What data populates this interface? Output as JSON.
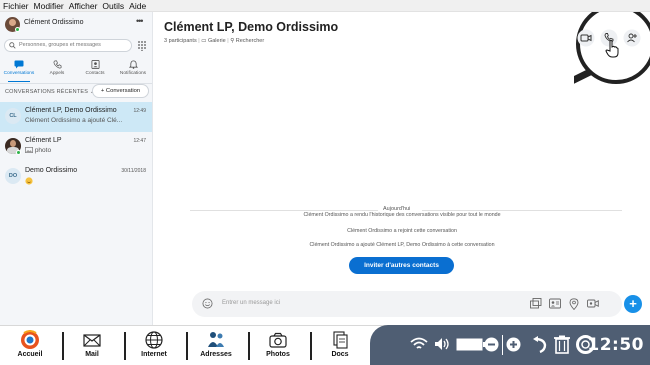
{
  "menubar": {
    "items": [
      "Fichier",
      "Modifier",
      "Afficher",
      "Outils",
      "Aide"
    ]
  },
  "sidebar": {
    "user_name": "Clément Ordissimo",
    "more_label": "•••",
    "search_placeholder": "Personnes, groupes et messages",
    "tabs": [
      {
        "label": "Conversations",
        "icon": "chat-icon"
      },
      {
        "label": "Appels",
        "icon": "phone-icon"
      },
      {
        "label": "Contacts",
        "icon": "contacts-icon"
      },
      {
        "label": "Notifications",
        "icon": "bell-icon"
      }
    ],
    "recent_label": "CONVERSATIONS RÉCENTES",
    "new_conversation_label": "+ Conversation",
    "conversations": [
      {
        "initials": "CL",
        "name": "Clément LP, Demo Ordissimo",
        "time": "12:49",
        "preview": "Clément Ordissimo a ajouté Clé..."
      },
      {
        "initials": "",
        "name": "Clément LP",
        "time": "12:47",
        "preview": "photo"
      },
      {
        "initials": "DO",
        "name": "Demo Ordissimo",
        "time": "30/11/2018",
        "preview": ""
      }
    ]
  },
  "chat": {
    "title": "Clément LP, Demo Ordissimo",
    "participants": "3 participants",
    "gallery": "Galerie",
    "search": "Rechercher",
    "today_label": "Aujourd'hui",
    "system_messages": [
      "Clément Ordissimo a rendu l'historique des conversations visible pour tout le monde",
      "Clément Ordissimo a rejoint cette conversation",
      "Clément Ordissimo a ajouté Clément LP, Demo Ordissimo à cette conversation"
    ],
    "invite_label": "Inviter d'autres contacts",
    "composer_placeholder": "Entrer un message ici"
  },
  "taskbar": {
    "items": [
      {
        "label": "Accueil",
        "icon": "home-logo-icon"
      },
      {
        "label": "Mail",
        "icon": "mail-icon"
      },
      {
        "label": "Internet",
        "icon": "globe-icon"
      },
      {
        "label": "Adresses",
        "icon": "address-book-icon"
      },
      {
        "label": "Photos",
        "icon": "camera-icon"
      },
      {
        "label": "Docs",
        "icon": "documents-icon"
      }
    ],
    "clock": "12:50"
  },
  "colors": {
    "accent": "#0a6fd1",
    "active_conversation": "#cde8f6",
    "system_tray": "#4f5e73"
  }
}
